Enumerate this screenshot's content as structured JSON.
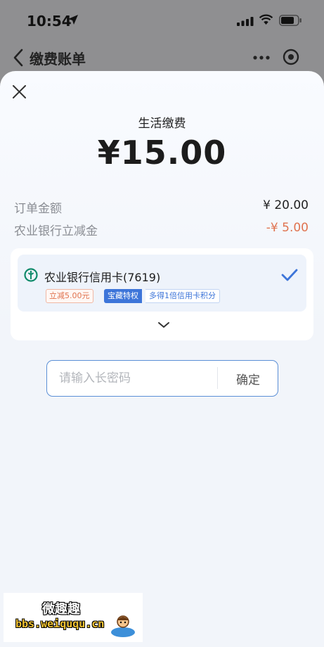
{
  "status_bar": {
    "time": "10:54"
  },
  "nav": {
    "title": "缴费账单"
  },
  "sheet": {
    "title": "生活缴费",
    "amount": "¥15.00",
    "rows": [
      {
        "label": "订单金额",
        "value": "¥ 20.00"
      },
      {
        "label": "农业银行立减金",
        "value": "-¥ 5.00"
      }
    ]
  },
  "payment_method": {
    "name": "农业银行信用卡(7619)",
    "tags": {
      "discount": "立减5.00元",
      "privilege": "宝藏特权",
      "points": "多得1倍信用卡积分"
    }
  },
  "password": {
    "placeholder": "请输入长密码",
    "confirm_label": "确定"
  },
  "watermark": {
    "text_cn": "微趣趣",
    "url": "bbs.weiququ.cn"
  },
  "colors": {
    "accent": "#3d75d9",
    "discount": "#e0734f",
    "input_border": "#5b8fd6",
    "bank_logo": "#0f8a6a"
  },
  "icons": [
    "location-arrow-icon",
    "signal-icon",
    "wifi-icon",
    "battery-icon",
    "back-chevron-icon",
    "more-icon",
    "target-icon",
    "close-icon",
    "abc-bank-logo-icon",
    "checkmark-icon",
    "chevron-down-icon"
  ]
}
